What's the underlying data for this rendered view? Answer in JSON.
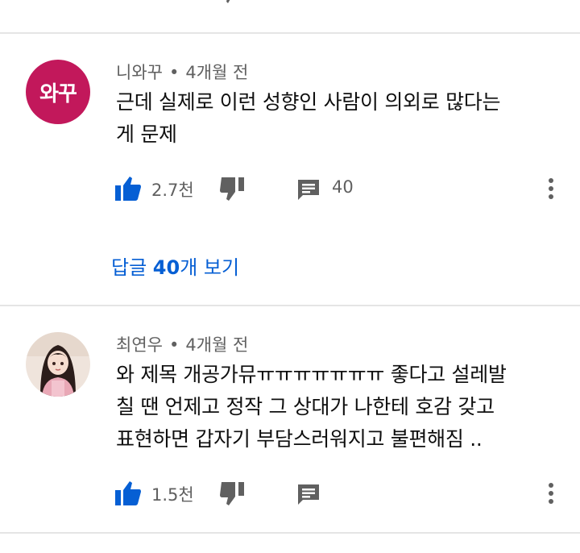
{
  "comments": [
    {
      "author": "니와꾸",
      "separator": "•",
      "time": "4개월 전",
      "avatar_text": "와꾸",
      "avatar_color": "#c2185b",
      "body_lines": [
        "근데 실제로 이런 성향인 사람이 의외로 많다는",
        "게 문제"
      ],
      "likes": "2.7천",
      "reply_count": "40",
      "view_replies_prefix": "답글 ",
      "view_replies_count": "40",
      "view_replies_suffix": "개 보기"
    },
    {
      "author": "최연우",
      "separator": "•",
      "time": "4개월 전",
      "body_lines": [
        "와 제목 개공가뮤ㅠㅠㅠㅠㅠㅠㅠ 좋다고 설레발",
        "칠 땐 언제고 정작 그 상대가 나한테 호감 갖고",
        "표현하면 갑자기 부담스러워지고 불편해짐 .."
      ],
      "likes": "1.5천"
    }
  ],
  "icons": {
    "like": "thumbs-up-filled-icon",
    "dislike": "thumbs-down-icon",
    "reply": "comment-icon",
    "more": "more-vertical-icon"
  },
  "colors": {
    "accent": "#065fd4",
    "icon_gray": "#606060",
    "divider": "#e5e5e5"
  }
}
